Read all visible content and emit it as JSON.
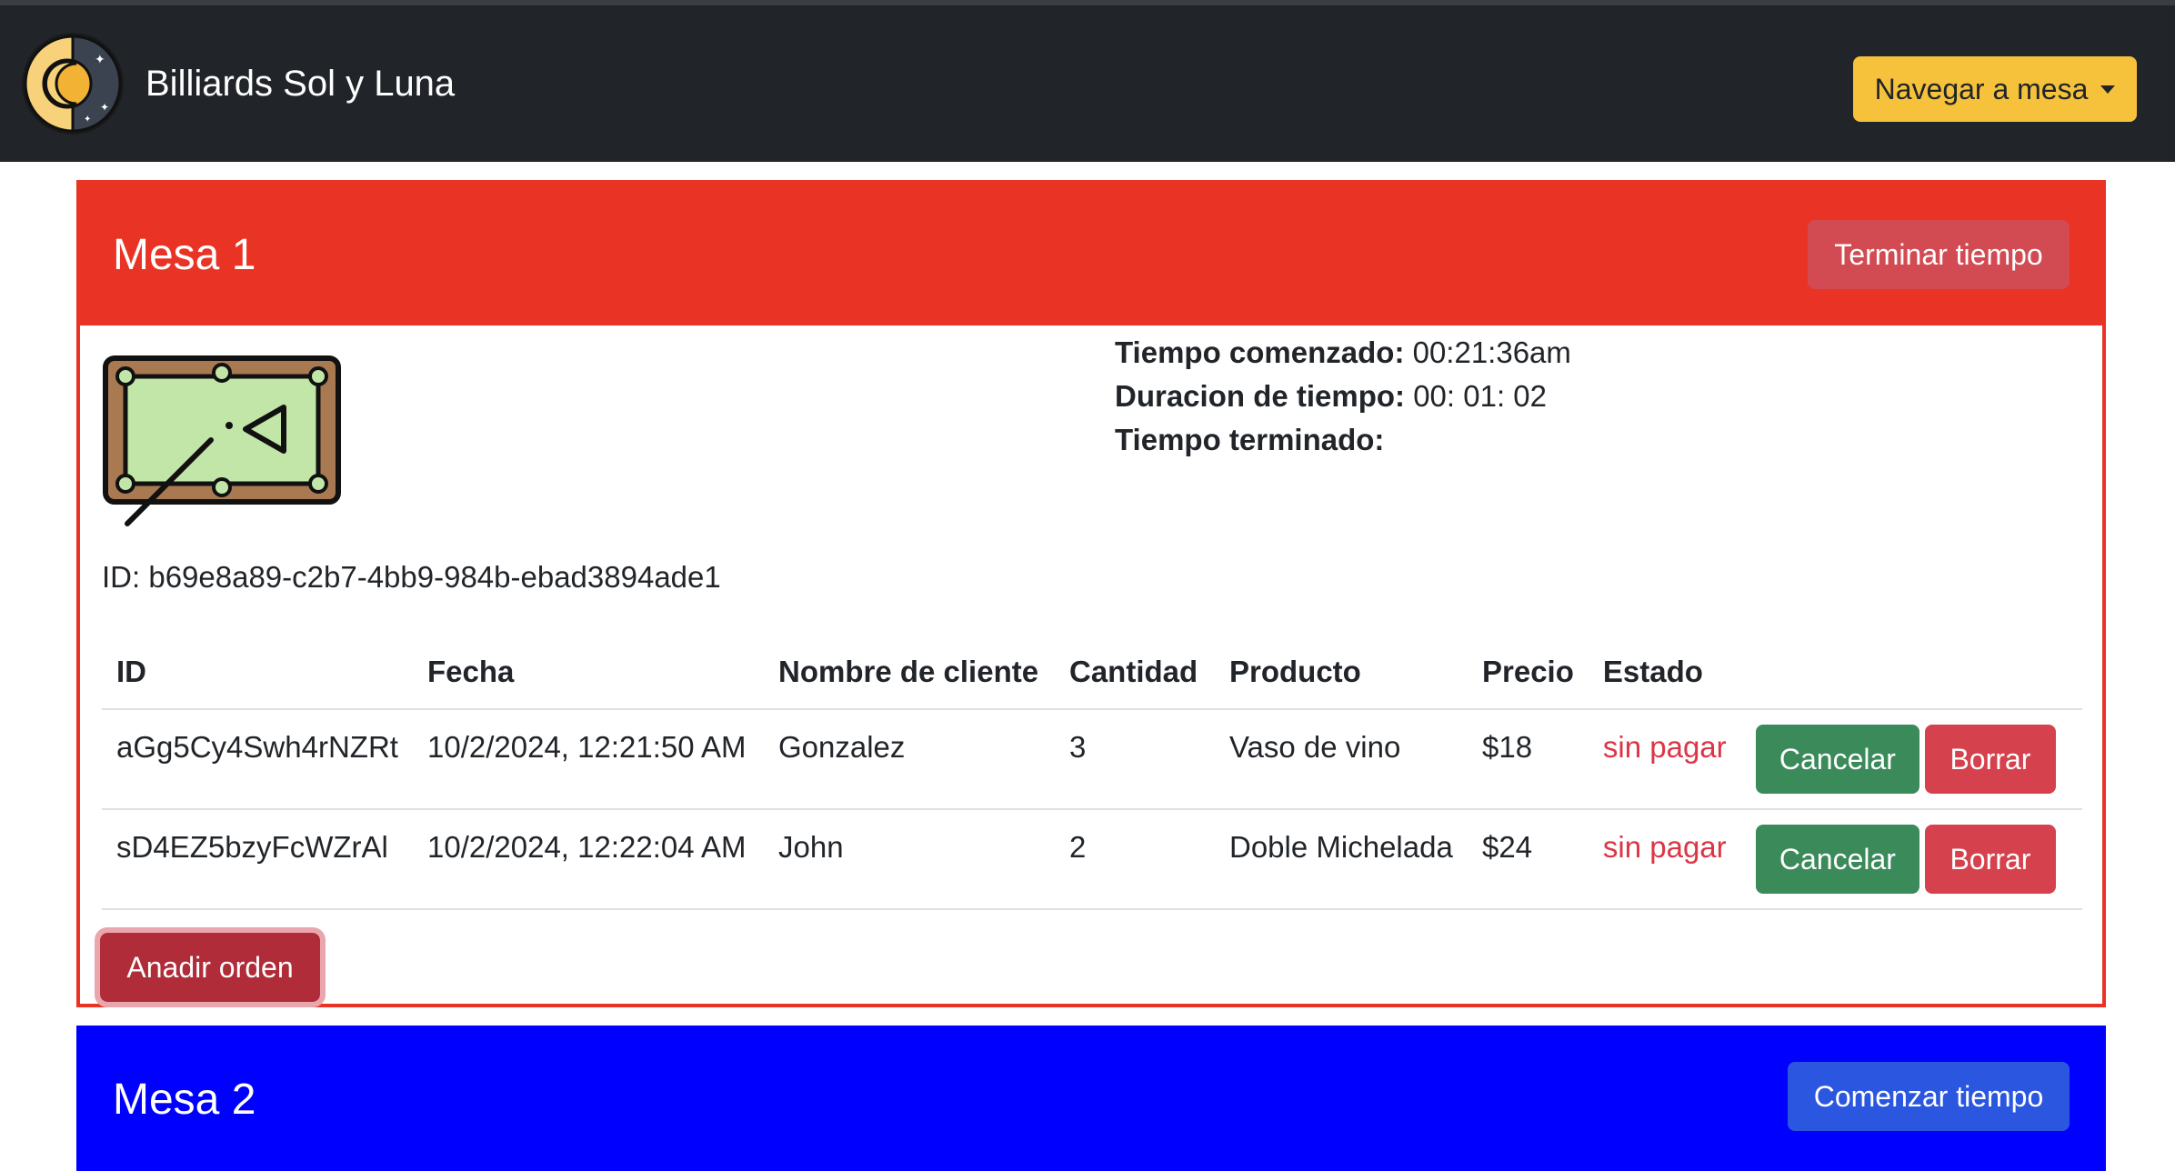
{
  "navbar": {
    "brand": "Billiards Sol y Luna",
    "logo_icon": "sun-moon-logo-icon",
    "dropdown_label": "Navegar a mesa"
  },
  "mesa1": {
    "title": "Mesa 1",
    "end_button": "Terminar tiempo",
    "header_color": "#e93324",
    "table_icon": "pool-table-icon",
    "started_label": "Tiempo comenzado:",
    "started_value": " 00:21:36am",
    "duration_label": "Duracion de tiempo:",
    "duration_value": " 00: 01: 02",
    "ended_label": "Tiempo terminado:",
    "ended_value": "",
    "id_text": "ID: b69e8a89-c2b7-4bb9-984b-ebad3894ade1",
    "columns": [
      "ID",
      "Fecha",
      "Nombre de cliente",
      "Cantidad",
      "Producto",
      "Precio",
      "Estado"
    ],
    "orders": [
      {
        "id": "aGg5Cy4Swh4rNZRt",
        "fecha": "10/2/2024, 12:21:50 AM",
        "cliente": "Gonzalez",
        "cantidad": "3",
        "producto": "Vaso de vino",
        "precio": "$18",
        "estado": "sin pagar",
        "cancel": "Cancelar",
        "delete": "Borrar"
      },
      {
        "id": "sD4EZ5bzyFcWZrAl",
        "fecha": "10/2/2024, 12:22:04 AM",
        "cliente": "John",
        "cantidad": "2",
        "producto": "Doble Michelada",
        "precio": "$24",
        "estado": "sin pagar",
        "cancel": "Cancelar",
        "delete": "Borrar"
      }
    ],
    "add_button": "Anadir orden"
  },
  "mesa2": {
    "title": "Mesa 2",
    "start_button": "Comenzar tiempo",
    "header_color": "#0000ff"
  }
}
